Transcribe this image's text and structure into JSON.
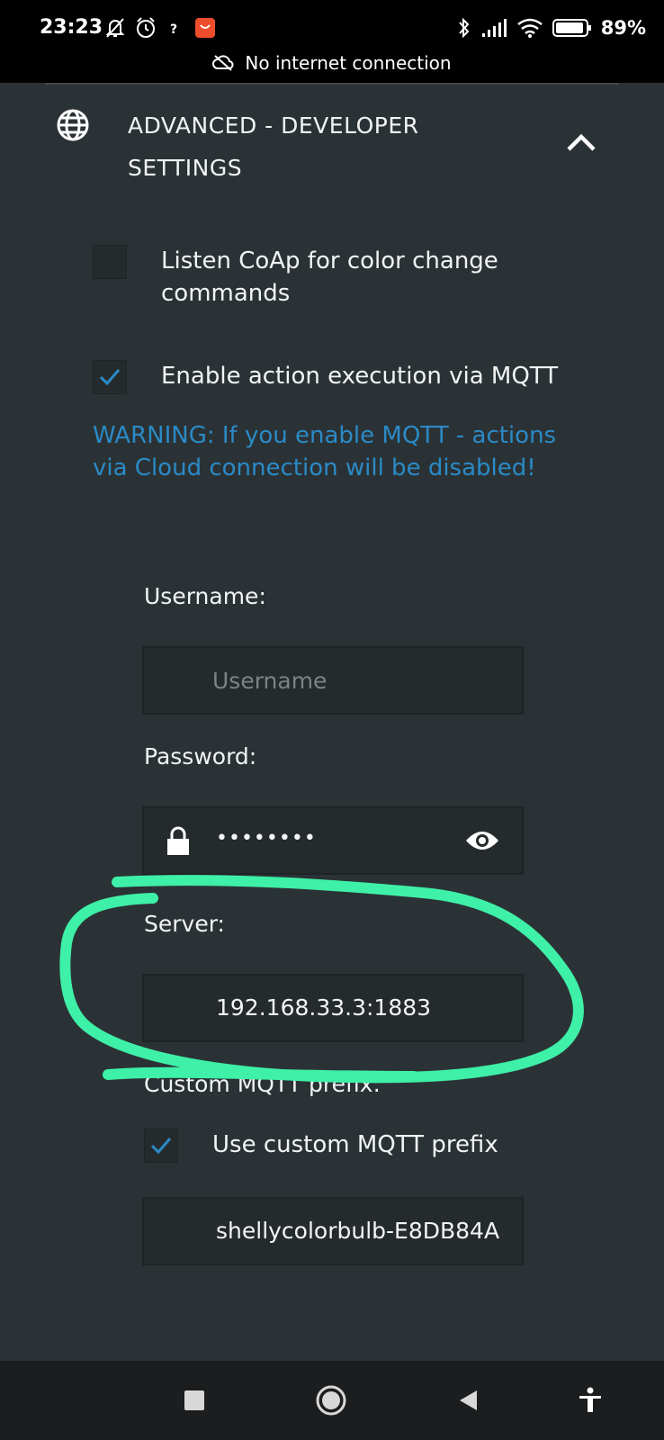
{
  "status_bar": {
    "time": "23:23",
    "battery_percent": "89%",
    "connection_notice": "No internet connection"
  },
  "section": {
    "title": "ADVANCED - DEVELOPER SETTINGS"
  },
  "options": {
    "coap": {
      "label": "Listen CoAp for color change commands",
      "checked": false
    },
    "mqtt": {
      "label": "Enable action execution via MQTT",
      "checked": true
    }
  },
  "warning": "WARNING: If you enable MQTT - actions via Cloud connection will be disabled!",
  "fields": {
    "username": {
      "label": "Username:",
      "placeholder": "Username",
      "value": ""
    },
    "password": {
      "label": "Password:",
      "masked_value": "••••••••"
    },
    "server": {
      "label": "Server:",
      "value": "192.168.33.3:1883"
    },
    "custom_prefix": {
      "label": "Custom MQTT prefix:",
      "checkbox_label": "Use custom MQTT prefix",
      "checked": true,
      "value": "shellycolorbulb-E8DB84A"
    }
  },
  "colors": {
    "background": "#2b3235",
    "accent": "#2b8ac6",
    "highlight": "#3ef0a8"
  }
}
